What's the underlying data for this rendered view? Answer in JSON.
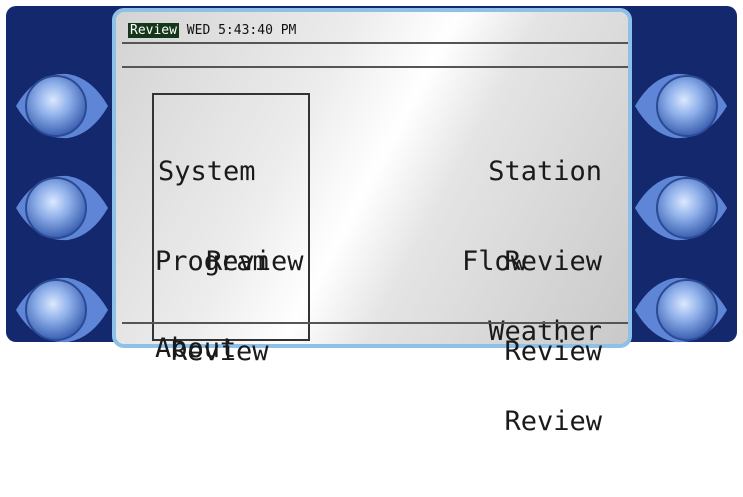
{
  "header": {
    "mode_badge": "Review",
    "datetime": "WED 5:43:40 PM"
  },
  "menu": {
    "system_review": [
      "System",
      "Review"
    ],
    "station_review": [
      "Station",
      "Review"
    ],
    "program_review": [
      "Program",
      "Review"
    ],
    "flow_review": [
      "Flow",
      "Review"
    ],
    "about": "About",
    "weather_review": [
      "Weather",
      "Review"
    ],
    "selected_item": "system_review"
  },
  "colors": {
    "frame": "#14286e",
    "screen_border": "#8fc0e8",
    "button_glow": "#7fa3e0",
    "selection_border": "#333333"
  },
  "softkeys": {
    "left": [
      "softkey-left-1",
      "softkey-left-2",
      "softkey-left-3"
    ],
    "right": [
      "softkey-right-1",
      "softkey-right-2",
      "softkey-right-3"
    ]
  }
}
